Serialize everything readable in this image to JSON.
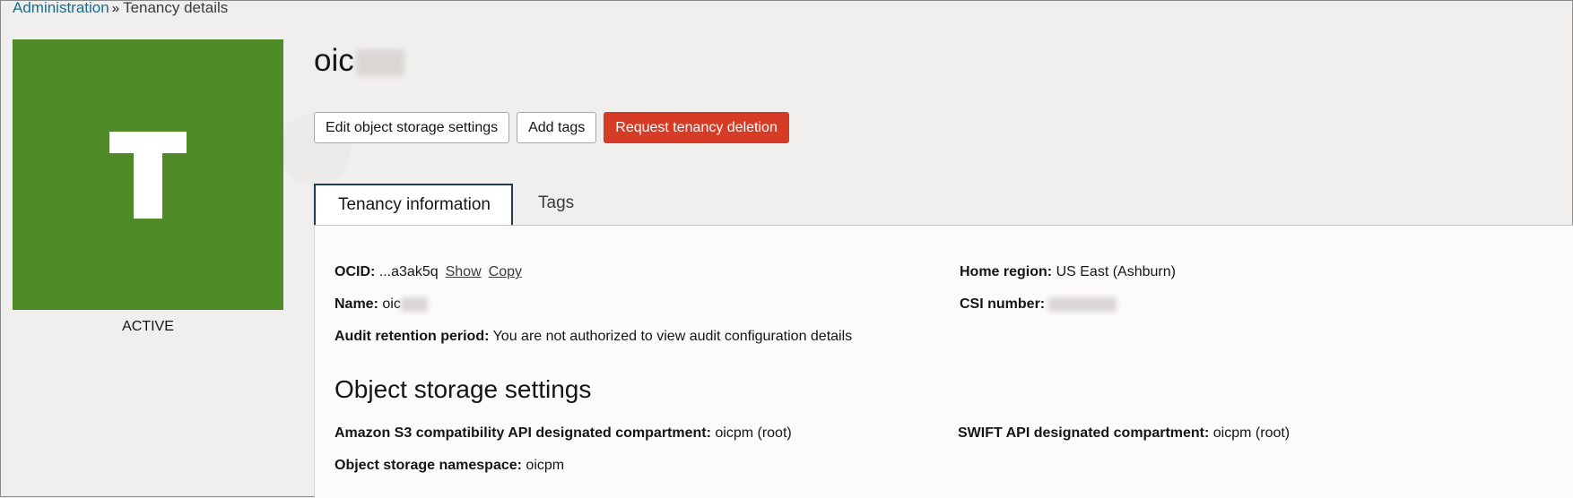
{
  "breadcrumb": {
    "parent": "Administration",
    "separator": "»",
    "current": "Tenancy details"
  },
  "avatar": {
    "letter": "T",
    "color": "#4e8a26",
    "status": "ACTIVE"
  },
  "title": "oic",
  "actions": {
    "edit_label": "Edit object storage settings",
    "add_tags_label": "Add tags",
    "delete_label": "Request tenancy deletion",
    "danger_color": "#d63b25"
  },
  "tabs": [
    {
      "label": "Tenancy information",
      "active": true
    },
    {
      "label": "Tags",
      "active": false
    }
  ],
  "info": {
    "ocid_label": "OCID:",
    "ocid_value": "...a3ak5q",
    "show_label": "Show",
    "copy_label": "Copy",
    "name_label": "Name:",
    "name_value": "oic",
    "audit_label": "Audit retention period:",
    "audit_value": "You are not authorized to view audit configuration details",
    "home_region_label": "Home region:",
    "home_region_value": "US East (Ashburn)",
    "csi_label": "CSI number:"
  },
  "object_storage": {
    "heading": "Object storage settings",
    "s3_label": "Amazon S3 compatibility API designated compartment:",
    "s3_value": "oicpm (root)",
    "swift_label": "SWIFT API designated compartment:",
    "swift_value": "oicpm (root)",
    "namespace_label": "Object storage namespace:",
    "namespace_value": "oicpm"
  }
}
